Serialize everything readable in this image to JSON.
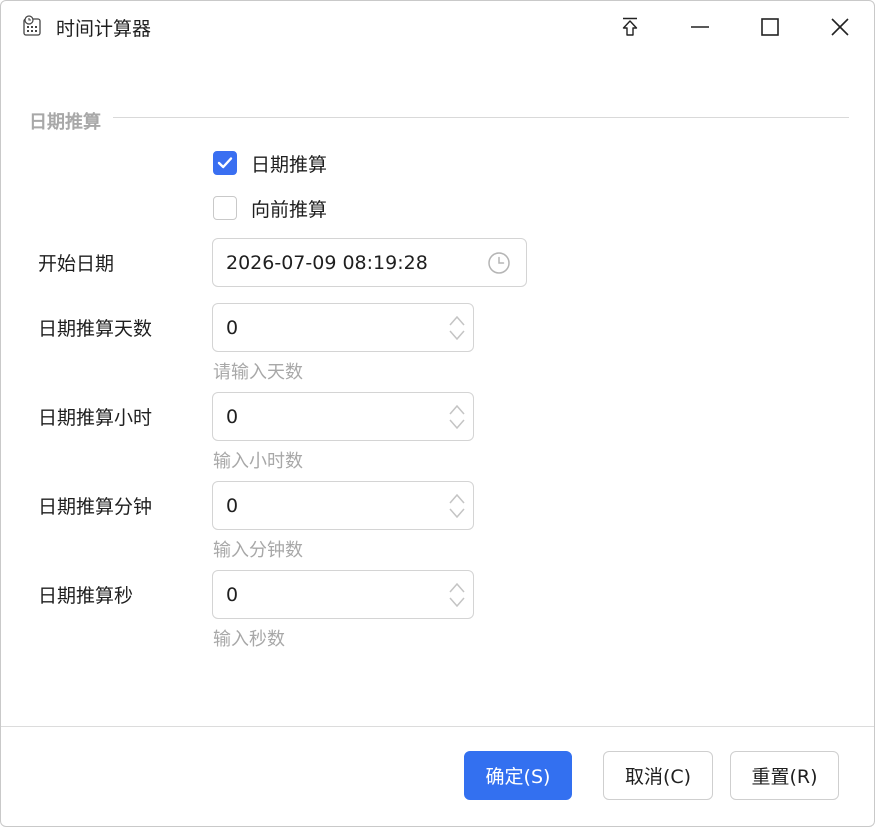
{
  "window": {
    "title": "时间计算器",
    "icons": {
      "app": "calculator-clock-icon",
      "pin": "pin-top-icon",
      "minimize": "minimize-icon",
      "maximize": "maximize-icon",
      "close": "close-icon"
    }
  },
  "group": {
    "title": "日期推算"
  },
  "checkboxes": [
    {
      "label": "日期推算",
      "checked": true
    },
    {
      "label": "向前推算",
      "checked": false
    }
  ],
  "form": {
    "start_date": {
      "label": "开始日期",
      "value": "2026-07-09 08:19:28",
      "icon": "clock-icon"
    },
    "days": {
      "label": "日期推算天数",
      "value": "0",
      "hint": "请输入天数"
    },
    "hours": {
      "label": "日期推算小时",
      "value": "0",
      "hint": "输入小时数"
    },
    "minutes": {
      "label": "日期推算分钟",
      "value": "0",
      "hint": "输入分钟数"
    },
    "seconds": {
      "label": "日期推算秒",
      "value": "0",
      "hint": "输入秒数"
    }
  },
  "buttons": {
    "ok": "确定(S)",
    "cancel": "取消(C)",
    "reset": "重置(R)"
  },
  "colors": {
    "accent": "#3370f0",
    "hint_text": "#a8a8a8",
    "border": "#d4d4d4"
  }
}
